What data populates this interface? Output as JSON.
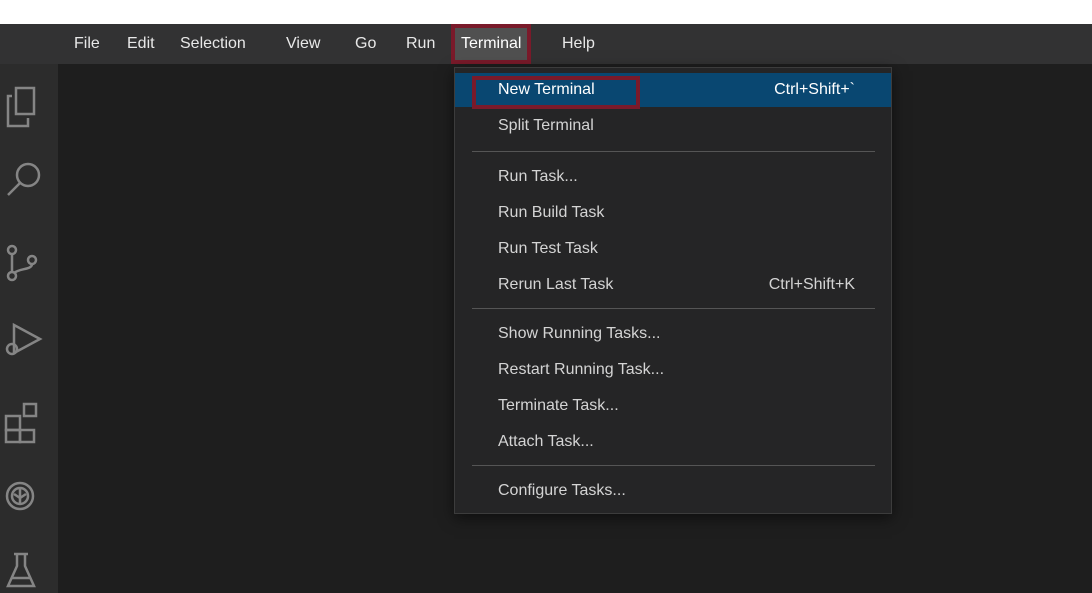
{
  "menubar": {
    "items": [
      {
        "label": "File"
      },
      {
        "label": "Edit"
      },
      {
        "label": "Selection"
      },
      {
        "label": "View"
      },
      {
        "label": "Go"
      },
      {
        "label": "Run"
      },
      {
        "label": "Terminal",
        "active": true
      },
      {
        "label": "Help"
      }
    ]
  },
  "activitybar": {
    "icons": [
      "explorer-icon",
      "search-icon",
      "source-control-icon",
      "run-debug-icon",
      "extensions-icon",
      "remote-icon",
      "testing-icon"
    ]
  },
  "terminal_menu": {
    "groups": [
      [
        {
          "label": "New Terminal",
          "shortcut": "Ctrl+Shift+`",
          "highlighted": true
        },
        {
          "label": "Split Terminal",
          "shortcut": ""
        }
      ],
      [
        {
          "label": "Run Task...",
          "shortcut": ""
        },
        {
          "label": "Run Build Task",
          "shortcut": ""
        },
        {
          "label": "Run Test Task",
          "shortcut": ""
        },
        {
          "label": "Rerun Last Task",
          "shortcut": "Ctrl+Shift+K"
        }
      ],
      [
        {
          "label": "Show Running Tasks...",
          "shortcut": ""
        },
        {
          "label": "Restart Running Task...",
          "shortcut": ""
        },
        {
          "label": "Terminate Task...",
          "shortcut": ""
        },
        {
          "label": "Attach Task...",
          "shortcut": ""
        }
      ],
      [
        {
          "label": "Configure Tasks...",
          "shortcut": ""
        }
      ]
    ]
  },
  "colors": {
    "menubar_bg": "#323233",
    "menu_bg": "#252526",
    "highlight_bg": "#094771",
    "annotation_border": "#7a1a2a"
  }
}
